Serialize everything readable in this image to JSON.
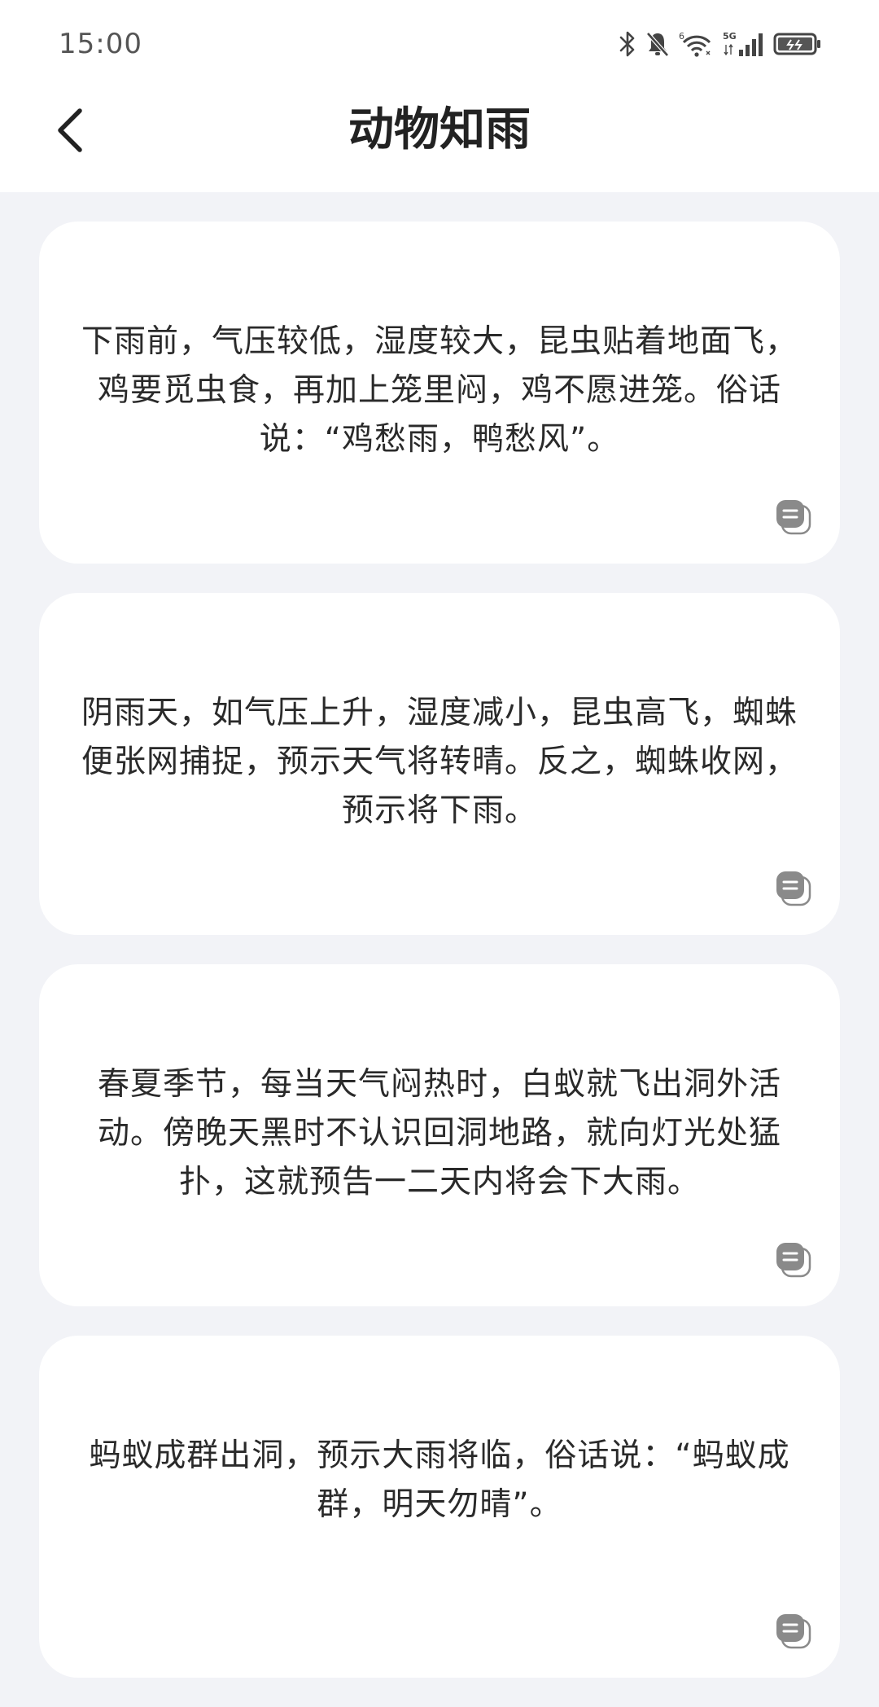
{
  "status_bar": {
    "time": "15:00",
    "icons": [
      "bluetooth-icon",
      "mute-bell-icon",
      "wifi-icon",
      "cellular-5g-icon",
      "battery-icon"
    ],
    "wifi_badge": "6",
    "network_badge": "5G"
  },
  "header": {
    "title": "动物知雨",
    "back_icon": "chevron-left-icon"
  },
  "cards": [
    {
      "text": "下雨前，气压较低，湿度较大，昆虫贴着地面飞，鸡要觅虫食，再加上笼里闷，鸡不愿进笼。俗话说：“鸡愁雨，鸭愁风”。",
      "action_icon": "copy-icon"
    },
    {
      "text": "阴雨天，如气压上升，湿度减小，昆虫高飞，蜘蛛便张网捕捉，预示天气将转晴。反之，蜘蛛收网，预示将下雨。",
      "action_icon": "copy-icon"
    },
    {
      "text": "春夏季节，每当天气闷热时，白蚁就飞出洞外活动。傍晚天黑时不认识回洞地路，就向灯光处猛扑，这就预告一二天内将会下大雨。",
      "action_icon": "copy-icon"
    },
    {
      "text": "蚂蚁成群出洞，预示大雨将临，俗话说：“蚂蚁成群，明天勿晴”。",
      "action_icon": "copy-icon"
    }
  ],
  "colors": {
    "page_background": "#f2f3f7",
    "card_background": "#ffffff",
    "text": "#2a2a2a",
    "icon_gray": "#8a8a8a"
  }
}
